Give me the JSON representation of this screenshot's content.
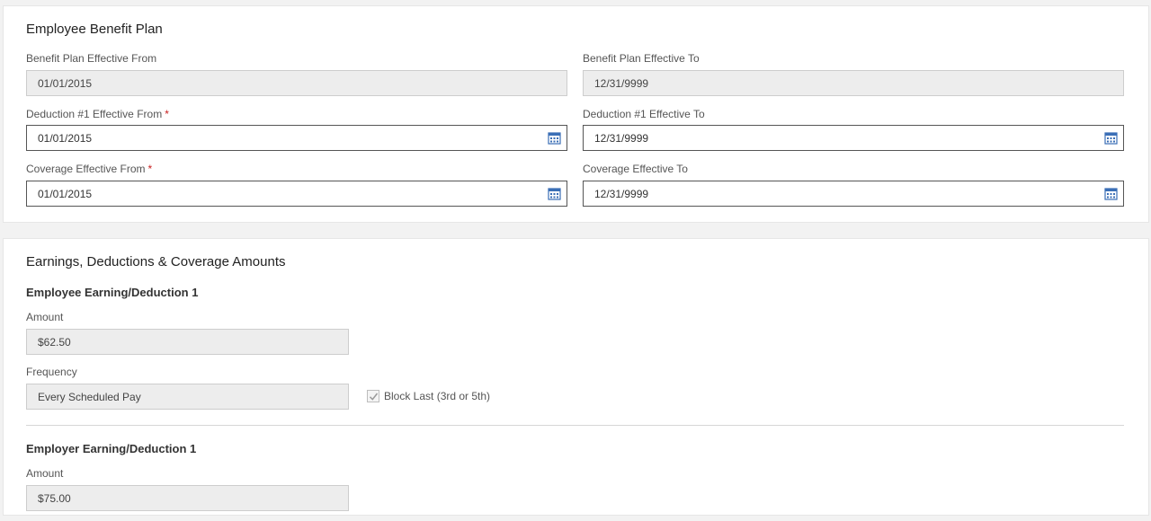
{
  "benefit_plan": {
    "title": "Employee Benefit Plan",
    "plan_from_label": "Benefit Plan Effective From",
    "plan_from_value": "01/01/2015",
    "plan_to_label": "Benefit Plan Effective To",
    "plan_to_value": "12/31/9999",
    "deduction_from_label": "Deduction #1 Effective From",
    "deduction_from_value": "01/01/2015",
    "deduction_to_label": "Deduction #1 Effective To",
    "deduction_to_value": "12/31/9999",
    "coverage_from_label": "Coverage Effective From",
    "coverage_from_value": "01/01/2015",
    "coverage_to_label": "Coverage Effective To",
    "coverage_to_value": "12/31/9999",
    "required_marker": "*"
  },
  "amounts": {
    "title": "Earnings, Deductions & Coverage Amounts",
    "employee": {
      "heading": "Employee Earning/Deduction 1",
      "amount_label": "Amount",
      "amount_value": "$62.50",
      "frequency_label": "Frequency",
      "frequency_value": "Every Scheduled Pay",
      "block_last_label": "Block Last (3rd or 5th)",
      "block_last_checked": true
    },
    "employer": {
      "heading": "Employer Earning/Deduction 1",
      "amount_label": "Amount",
      "amount_value": "$75.00"
    }
  },
  "icons": {
    "calendar": "calendar-icon",
    "checkmark": "checkmark-icon"
  },
  "colors": {
    "required": "#c81e1e",
    "calendar_icon": "#3b6fb6",
    "readonly_bg": "#ededed"
  }
}
